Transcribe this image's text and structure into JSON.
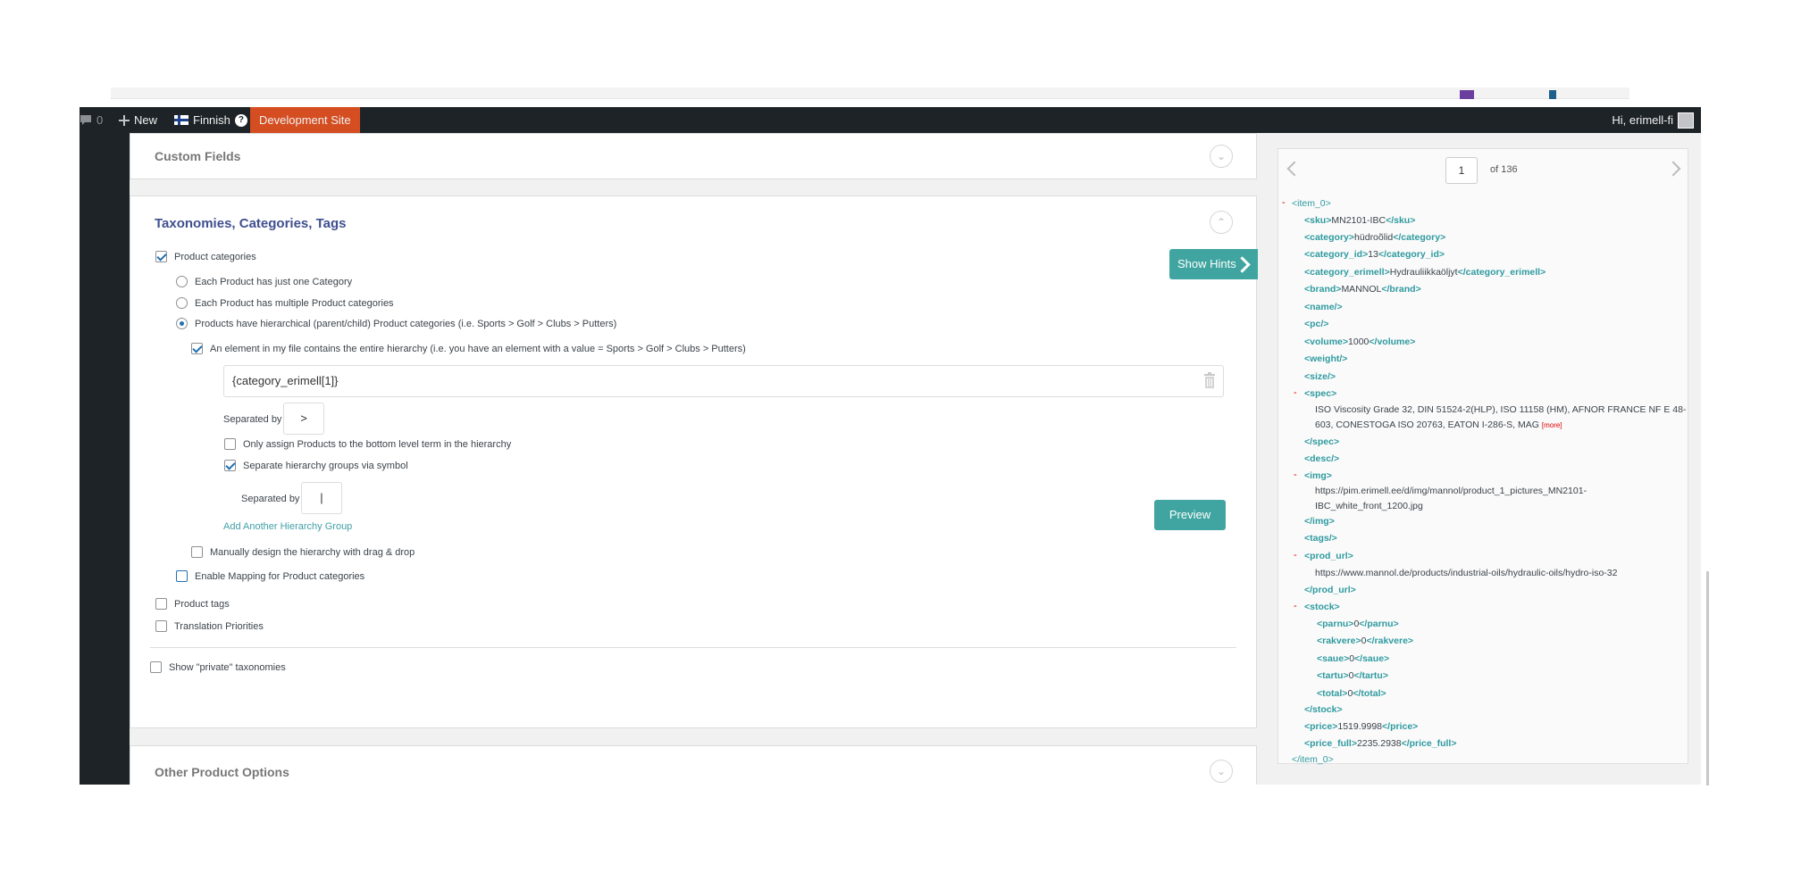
{
  "adminbar": {
    "comments_count": "0",
    "new_label": "New",
    "language_label": "Finnish",
    "help_glyph": "?",
    "site_label": "Development Site",
    "greeting": "Hi, erimell-fi"
  },
  "panels": {
    "custom_fields_title": "Custom Fields",
    "taxonomies_title": "Taxonomies, Categories, Tags",
    "other_options_title": "Other Product Options"
  },
  "taxonomies": {
    "product_categories_label": "Product categories",
    "radio_one": "Each Product has just one Category",
    "radio_multiple": "Each Product has multiple Product categories",
    "radio_hierarchical": "Products have hierarchical (parent/child) Product categories (i.e. Sports > Golf > Clubs > Putters)",
    "entire_hierarchy_label": "An element in my file contains the entire hierarchy (i.e. you have an element with a value = Sports > Golf > Clubs > Putters)",
    "category_value": "{category_erimell[1]}",
    "separated_by_label": "Separated by",
    "separator_value": ">",
    "bottom_level_label": "Only assign Products to the bottom level term in the hierarchy",
    "separate_groups_label": "Separate hierarchy groups via symbol",
    "separated_by_label_2": "Separated by",
    "group_separator_value": "|",
    "add_group_link": "Add Another Hierarchy Group",
    "manual_design_label": "Manually design the hierarchy with drag & drop",
    "enable_mapping_label": "Enable Mapping for Product categories",
    "product_tags_label": "Product tags",
    "translation_priorities_label": "Translation Priorities",
    "show_private_label": "Show \"private\" taxonomies",
    "show_hints_label": "Show Hints",
    "preview_label": "Preview"
  },
  "xml_preview": {
    "page_value": "1",
    "of_label": "of 136",
    "more_label": "[more]",
    "lines": {
      "item_open": "<item_0>",
      "sku_open": "<sku>",
      "sku_val": "MN2101-IBC",
      "sku_close": "</sku>",
      "category_open": "<category>",
      "category_val": "hüdroõlid",
      "category_close": "</category>",
      "category_id_open": "<category_id>",
      "category_id_val": "13",
      "category_id_close": "</category_id>",
      "category_erimell_open": "<category_erimell>",
      "category_erimell_val": "Hydrauliikkaöljyt",
      "category_erimell_close": "</category_erimell>",
      "brand_open": "<brand>",
      "brand_val": "MANNOL",
      "brand_close": "</brand>",
      "name": "<name/>",
      "pc": "<pc/>",
      "volume_open": "<volume>",
      "volume_val": "1000",
      "volume_close": "</volume>",
      "weight": "<weight/>",
      "size": "<size/>",
      "spec_open": "<spec>",
      "spec_val_1": "ISO Viscosity Grade 32, DIN 51524-2(HLP), ISO 11158 (HM), AFNOR FRANCE NF E 48-",
      "spec_val_2": "603, CONESTOGA ISO 20763, EATON I-286-S, MAG",
      "spec_close": "</spec>",
      "desc": "<desc/>",
      "img_open": "<img>",
      "img_val_1": "https://pim.erimell.ee/d/img/mannol/product_1_pictures_MN2101-",
      "img_val_2": "IBC_white_front_1200.jpg",
      "img_close": "</img>",
      "tags": "<tags/>",
      "prod_url_open": "<prod_url>",
      "prod_url_val": "https://www.mannol.de/products/industrial-oils/hydraulic-oils/hydro-iso-32",
      "prod_url_close": "</prod_url>",
      "stock_open": "<stock>",
      "parnu_open": "<parnu>",
      "parnu_val": "0",
      "parnu_close": "</parnu>",
      "rakvere_open": "<rakvere>",
      "rakvere_val": "0",
      "rakvere_close": "</rakvere>",
      "saue_open": "<saue>",
      "saue_val": "0",
      "saue_close": "</saue>",
      "tartu_open": "<tartu>",
      "tartu_val": "0",
      "tartu_close": "</tartu>",
      "total_open": "<total>",
      "total_val": "0",
      "total_close": "</total>",
      "stock_close": "</stock>",
      "price_open": "<price>",
      "price_val": "1519.9998",
      "price_close": "</price>",
      "price_full_open": "<price_full>",
      "price_full_val": "2235.2938",
      "price_full_close": "</price_full>",
      "item_close": "</item_0>",
      "collapse_glyph": "-"
    }
  }
}
